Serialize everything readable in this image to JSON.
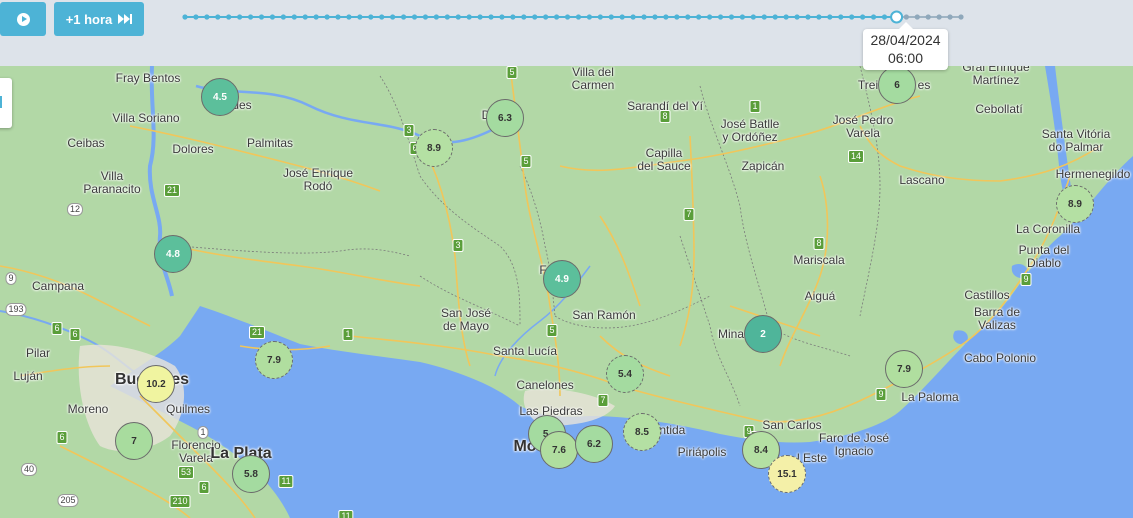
{
  "controls": {
    "play_icon": "play-circle-icon",
    "step_label": "+1 hora",
    "step_icon": "fast-forward-icon",
    "timeline_ticks_done": 66,
    "timeline_ticks_pending": 6,
    "timeline_position": 0.917,
    "tooltip_date": "28/04/2024",
    "tooltip_time": "06:00",
    "accent_color": "#4db3d6"
  },
  "map": {
    "land_color": "#b2d8a6",
    "water_color": "#78a9f2",
    "places": [
      {
        "id": "fray-bentos",
        "text": "Fray Bentos"
      },
      {
        "id": "mercedes",
        "text": "des"
      },
      {
        "id": "villa-soriano",
        "text": "Villa Soriano"
      },
      {
        "id": "ceibas",
        "text": "Ceibas"
      },
      {
        "id": "dolores",
        "text": "Dolores"
      },
      {
        "id": "palmitas",
        "text": "Palmitas"
      },
      {
        "id": "villa-paranacito",
        "text": "Villa\nParanacito"
      },
      {
        "id": "jose-enrique-rodo",
        "text": "José Enrique\nRodó"
      },
      {
        "id": "villa-del-carmen",
        "text": "Villa del\nCarmen"
      },
      {
        "id": "sarandi-del-yi",
        "text": "Sarandí del Yí"
      },
      {
        "id": "jose-batlle",
        "text": "José Batlle\ny Ordóñez"
      },
      {
        "id": "jose-pedro-varela",
        "text": "José Pedro\nVarela"
      },
      {
        "id": "capilla-del-sauce",
        "text": "Capilla\ndel Sauce"
      },
      {
        "id": "zapican",
        "text": "Zapicán"
      },
      {
        "id": "treinta-tres",
        "text": "Trei"
      },
      {
        "id": "treinta-tres-2",
        "text": "es"
      },
      {
        "id": "gral-enrique-martinez",
        "text": "Gral Enrique\nMartínez"
      },
      {
        "id": "cebollati",
        "text": "Cebollatí"
      },
      {
        "id": "santa-vitoria",
        "text": "Santa Vitória\ndo Palmar"
      },
      {
        "id": "hermenegildo",
        "text": "Hermenegildo"
      },
      {
        "id": "lascano",
        "text": "Lascano"
      },
      {
        "id": "la-coronilla",
        "text": "La Coronilla"
      },
      {
        "id": "punta-del-diablo",
        "text": "Punta del\nDiablo"
      },
      {
        "id": "mariscala",
        "text": "Mariscala"
      },
      {
        "id": "aigua",
        "text": "Aiguá"
      },
      {
        "id": "castillos",
        "text": "Castillos"
      },
      {
        "id": "barra-de-valizas",
        "text": "Barra de\nValizas"
      },
      {
        "id": "cabo-polonio",
        "text": "Cabo Polonio"
      },
      {
        "id": "la-paloma",
        "text": "La Paloma"
      },
      {
        "id": "minas",
        "text": "Mina"
      },
      {
        "id": "campana",
        "text": "Campana"
      },
      {
        "id": "san-jose",
        "text": "San José\nde Mayo"
      },
      {
        "id": "san-ramon",
        "text": "San Ramón"
      },
      {
        "id": "santa-lucia",
        "text": "Santa Lucía"
      },
      {
        "id": "canelones",
        "text": "Canelones"
      },
      {
        "id": "las-piedras",
        "text": "Las Piedras"
      },
      {
        "id": "atlantida",
        "text": "ántida"
      },
      {
        "id": "piriapolis",
        "text": "Piriápolis"
      },
      {
        "id": "san-carlos",
        "text": "San Carlos"
      },
      {
        "id": "punta-del-este",
        "text": "l Este"
      },
      {
        "id": "faro-jose-ignacio",
        "text": "Faro de José\nIgnacio"
      },
      {
        "id": "pilar",
        "text": "Pilar"
      },
      {
        "id": "lujan",
        "text": "Luján"
      },
      {
        "id": "moreno",
        "text": "Moreno"
      },
      {
        "id": "quilmes",
        "text": "Quilmes"
      },
      {
        "id": "florencio-varela",
        "text": "Florencio\nVarela"
      },
      {
        "id": "la-plata",
        "text": "La Plata"
      },
      {
        "id": "buenos-aires",
        "text": "Bue           Aires"
      },
      {
        "id": "montevideo",
        "text": "Mo"
      },
      {
        "id": "florida",
        "text": "F"
      },
      {
        "id": "durazno",
        "text": "D"
      }
    ],
    "routes": [
      "5",
      "3",
      "6",
      "5",
      "7",
      "8",
      "14",
      "3",
      "1",
      "5",
      "7",
      "8",
      "9",
      "9",
      "9",
      "21",
      "1",
      "12",
      "21",
      "6",
      "9",
      "193",
      "6",
      "1",
      "40",
      "53",
      "205",
      "210",
      "11",
      "11",
      "6",
      "6",
      "8"
    ]
  },
  "stations": [
    {
      "id": "s1",
      "value": "4.5",
      "color": "#5cbf9b",
      "style": "solid"
    },
    {
      "id": "s2",
      "value": "6.3",
      "color": "#a4dba0",
      "style": "solid"
    },
    {
      "id": "s3",
      "value": "8.9",
      "color": "#b4e0a3",
      "style": "dash"
    },
    {
      "id": "s4",
      "value": "6",
      "color": "#a4dba0",
      "style": "solid"
    },
    {
      "id": "s5",
      "value": "8.9",
      "color": "#b4e0a3",
      "style": "dash"
    },
    {
      "id": "s6",
      "value": "4.8",
      "color": "#5cbf9b",
      "style": "solid"
    },
    {
      "id": "s7",
      "value": "4.9",
      "color": "#5cbf9b",
      "style": "solid"
    },
    {
      "id": "s8",
      "value": "2",
      "color": "#4fb59a",
      "style": "solid"
    },
    {
      "id": "s9",
      "value": "7.9",
      "color": "#b0de9f",
      "style": "dash"
    },
    {
      "id": "s10",
      "value": "7.9",
      "color": "#b0de9f",
      "style": "solid"
    },
    {
      "id": "s11",
      "value": "10.2",
      "color": "#f0f4a0",
      "style": "solid"
    },
    {
      "id": "s12",
      "value": "5.4",
      "color": "#a4dba0",
      "style": "dash"
    },
    {
      "id": "s13",
      "value": "7",
      "color": "#a8dc9e",
      "style": "solid"
    },
    {
      "id": "s14",
      "value": "5.",
      "color": "#a4dba0",
      "style": "solid"
    },
    {
      "id": "s15",
      "value": "7.6",
      "color": "#b0de9f",
      "style": "solid"
    },
    {
      "id": "s16",
      "value": "6.2",
      "color": "#a4dba0",
      "style": "solid"
    },
    {
      "id": "s17",
      "value": "8.5",
      "color": "#b4e0a3",
      "style": "dash"
    },
    {
      "id": "s18",
      "value": "8.4",
      "color": "#b4e0a3",
      "style": "solid"
    },
    {
      "id": "s19",
      "value": "15.1",
      "color": "#f4f0a8",
      "style": "dash"
    },
    {
      "id": "s20",
      "value": "5.8",
      "color": "#a4dba0",
      "style": "solid"
    }
  ]
}
